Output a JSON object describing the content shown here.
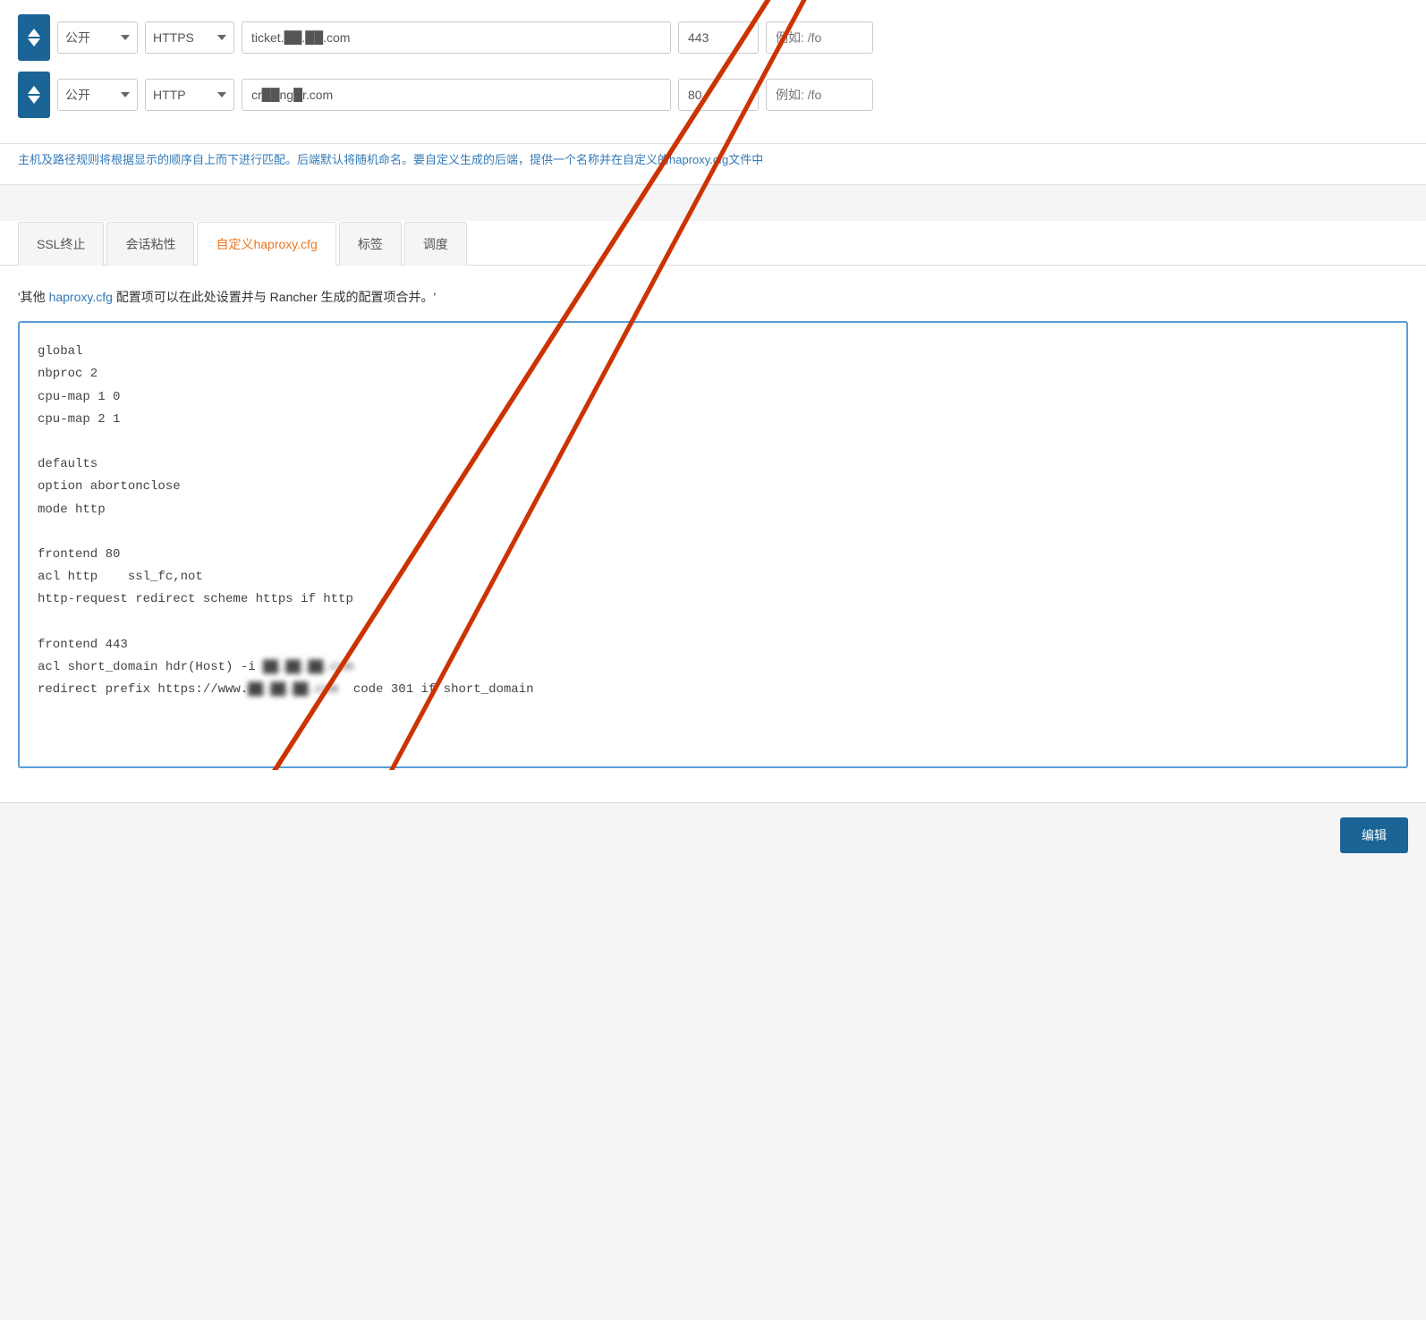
{
  "rows": [
    {
      "access": "公开",
      "protocol": "HTTPS",
      "domain": "ticket.██.██.com",
      "port": "443",
      "path_placeholder": "例如: /fo"
    },
    {
      "access": "公开",
      "protocol": "HTTP",
      "domain": "cr██ng█r.com",
      "port": "80",
      "path_placeholder": "例如: /fo"
    }
  ],
  "info_text": "主机及路径规则将根据显示的顺序自上而下进行匹配。后端默认将随机命名。要自定义生成的后端，提供一个名称并在自定义的haproxy.cfg文件中",
  "tabs": [
    {
      "id": "ssl",
      "label": "SSL终止",
      "active": false
    },
    {
      "id": "sticky",
      "label": "会话粘性",
      "active": false
    },
    {
      "id": "haproxy",
      "label": "自定义haproxy.cfg",
      "active": true
    },
    {
      "id": "labels",
      "label": "标签",
      "active": false
    },
    {
      "id": "schedule",
      "label": "调度",
      "active": false
    }
  ],
  "description": "'其他 haproxy.cfg 配置项可以在此处设置并与 Rancher 生成的配置项合并。'",
  "description_link": "haproxy.cfg",
  "code_lines": [
    "global",
    "nbproc 2",
    "cpu-map 1 0",
    "cpu-map 2 1",
    "",
    "defaults",
    "option abortonclose",
    "mode http",
    "",
    "frontend 80",
    "acl http    ssl_fc,not",
    "http-request redirect scheme https if http",
    "",
    "frontend 443",
    "acl short_domain hdr(Host) -i ██.██.██.com",
    "redirect prefix https://www.██.██.██.com  code 301 if short_domain"
  ],
  "bottom_bar": {
    "edit_button": "编辑"
  }
}
